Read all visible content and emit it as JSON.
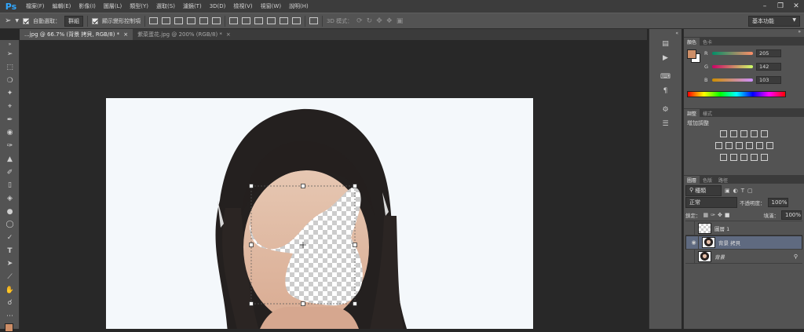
{
  "app": {
    "logo": "Ps"
  },
  "menu": [
    "檔案(F)",
    "編輯(E)",
    "影像(I)",
    "圖層(L)",
    "類型(Y)",
    "選取(S)",
    "濾鏡(T)",
    "3D(D)",
    "檢視(V)",
    "視窗(W)",
    "說明(H)"
  ],
  "options": {
    "auto_select_label": "自動選取：",
    "auto_select_value": "群組",
    "transform_label": "顯示變形控制項",
    "mode3d_label": "3D 模式：",
    "workspace": "基本功能"
  },
  "tabs": [
    {
      "label": "...jpg @ 66.7% (背景 拷貝, RGB/8) *",
      "close": "×"
    },
    {
      "label": "紫菜蛋花.jpg @ 200% (RGB/8) *",
      "close": "×"
    }
  ],
  "color_panel": {
    "tabs": [
      "顏色",
      "色卡"
    ],
    "r_label": "R",
    "r_value": "205",
    "g_label": "G",
    "g_value": "142",
    "b_label": "B",
    "b_value": "103",
    "fg_color": "#cd8e67",
    "bg_color": "#ffffff"
  },
  "adjust_panel": {
    "tabs": [
      "調整",
      "樣式"
    ],
    "title": "增加調整"
  },
  "layers_panel": {
    "tabs": [
      "圖層",
      "色版",
      "路徑"
    ],
    "filter_label": "種類",
    "blend_mode": "正常",
    "opacity_label": "不透明度：",
    "opacity_value": "100%",
    "lock_label": "鎖定：",
    "fill_label": "填滿：",
    "fill_value": "100%",
    "layers": [
      {
        "name": "圖層 1",
        "visible": false,
        "selected": false
      },
      {
        "name": "背景 拷貝",
        "visible": true,
        "selected": true
      },
      {
        "name": "背景",
        "visible": false,
        "selected": false
      }
    ]
  }
}
